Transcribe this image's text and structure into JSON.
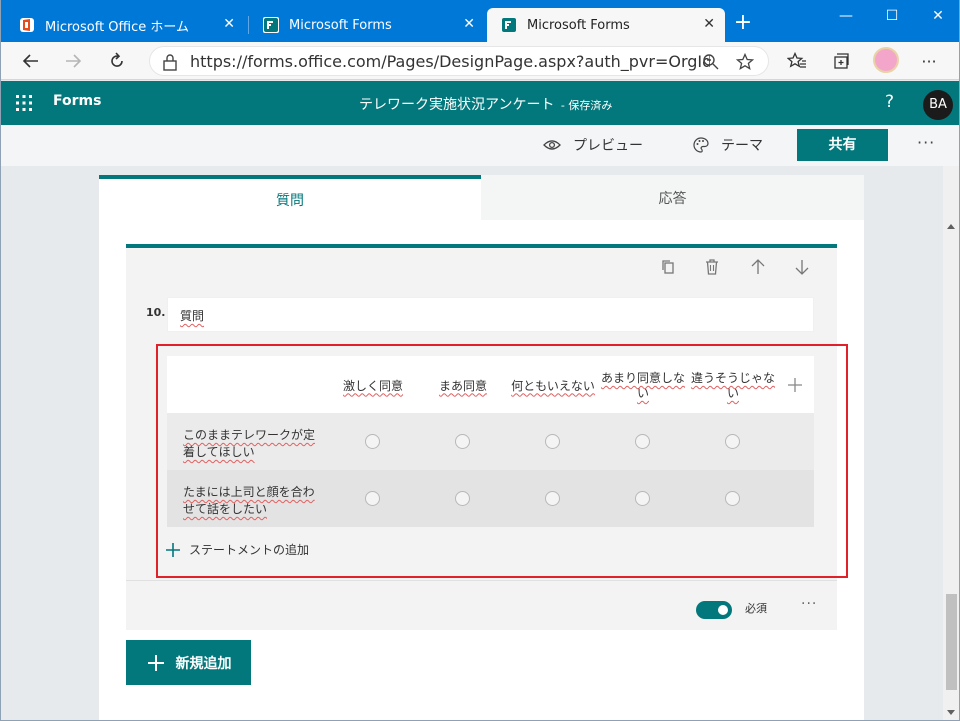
{
  "browser": {
    "tabs": [
      {
        "title": "Microsoft Office ホーム",
        "active": false
      },
      {
        "title": "Microsoft Forms",
        "active": false
      },
      {
        "title": "Microsoft Forms",
        "active": true
      }
    ],
    "new_tab_label": "+",
    "window_controls": {
      "minimize": "—",
      "maximize": "☐",
      "close": "✕"
    },
    "url": "https://forms.office.com/Pages/DesignPage.aspx?auth_pvr=OrgId&a...",
    "more_label": "···"
  },
  "app": {
    "name": "Forms",
    "form_title": "テレワーク実施状況アンケート",
    "save_status": "- 保存済み",
    "help_label": "?",
    "avatar_initials": "BA",
    "brand_color": "#03787c"
  },
  "commands": {
    "preview_label": "プレビュー",
    "theme_label": "テーマ",
    "share_label": "共有",
    "more_label": "···"
  },
  "form_tabs": {
    "questions_label": "質問",
    "responses_label": "応答",
    "active": "questions"
  },
  "question": {
    "number": "10.",
    "title": "質問",
    "type": "likert",
    "options": [
      "激しく同意",
      "まあ同意",
      "何ともいえない",
      "あまり同意しない",
      "違うそうじゃない"
    ],
    "statements": [
      "このままテレワークが定着してほしい",
      "たまには上司と顔を合わせて話をしたい"
    ],
    "add_statement_label": "ステートメントの追加",
    "required_label": "必須",
    "required": true,
    "more_label": "···"
  },
  "add_new_label": "新規追加",
  "highlight_color": "#e0202a"
}
